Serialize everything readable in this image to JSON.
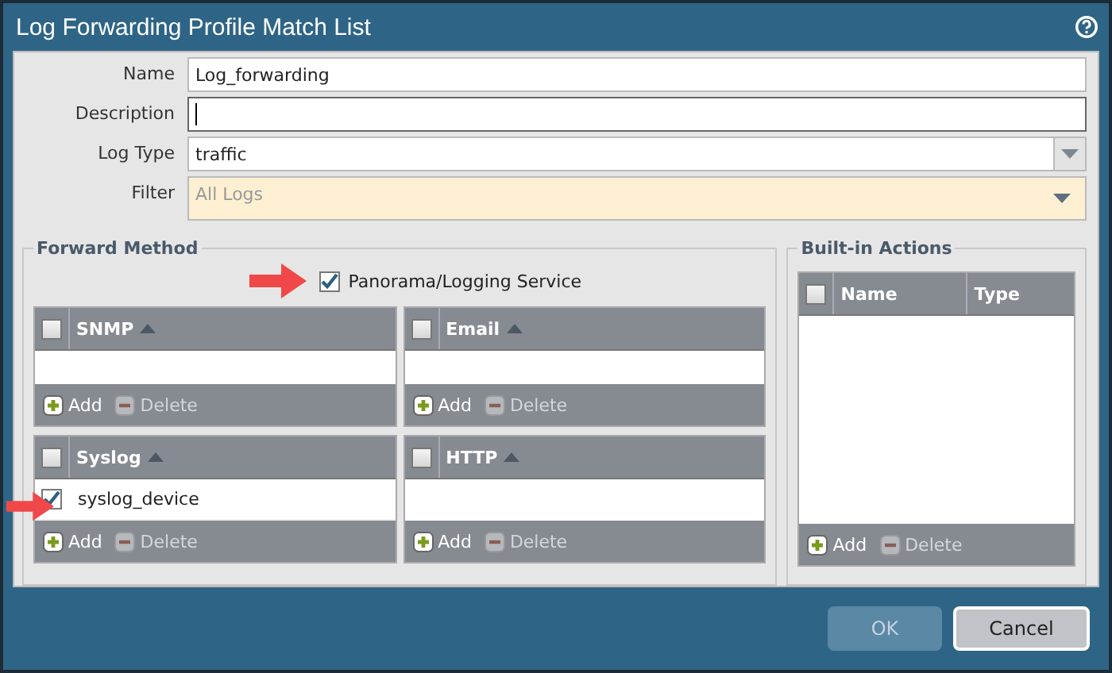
{
  "dialog": {
    "title": "Log Forwarding Profile Match List"
  },
  "fields": [
    {
      "label": "Name",
      "kind": "text",
      "value": "Log_forwarding",
      "focused": false
    },
    {
      "label": "Description",
      "kind": "text",
      "focused": true
    },
    {
      "label": "Log Type",
      "kind": "dropdown",
      "value": "traffic"
    },
    {
      "label": "Filter",
      "kind": "filter",
      "placeholder": "All Logs"
    }
  ],
  "forward_method": {
    "title": "Forward Method",
    "panorama": {
      "label": "Panorama/Logging Service",
      "checked": true
    },
    "tables": [
      {
        "header": "SNMP",
        "header_checked": false,
        "buttons": [
          {
            "label": "Add",
            "disabled": false
          },
          {
            "label": "Delete",
            "disabled": true
          }
        ]
      },
      {
        "header": "Email",
        "header_checked": false,
        "buttons": [
          {
            "label": "Add",
            "disabled": false
          },
          {
            "label": "Delete",
            "disabled": true
          }
        ]
      },
      {
        "header": "Syslog",
        "header_checked": false,
        "rows": [
          {
            "label": "syslog_device",
            "checked": true
          }
        ],
        "buttons": [
          {
            "label": "Add",
            "disabled": false
          },
          {
            "label": "Delete",
            "disabled": true
          }
        ]
      },
      {
        "header": "HTTP",
        "header_checked": false,
        "buttons": [
          {
            "label": "Add",
            "disabled": false
          },
          {
            "label": "Delete",
            "disabled": true
          }
        ]
      }
    ]
  },
  "builtin_actions": {
    "title": "Built-in Actions",
    "header_checked": false,
    "columns": [
      "Name",
      "Type"
    ],
    "buttons": [
      {
        "label": "Add",
        "disabled": false
      },
      {
        "label": "Delete",
        "disabled": true
      }
    ]
  },
  "footer_buttons": [
    {
      "label": "OK",
      "disabled": true
    },
    {
      "label": "Cancel",
      "disabled": false
    }
  ]
}
